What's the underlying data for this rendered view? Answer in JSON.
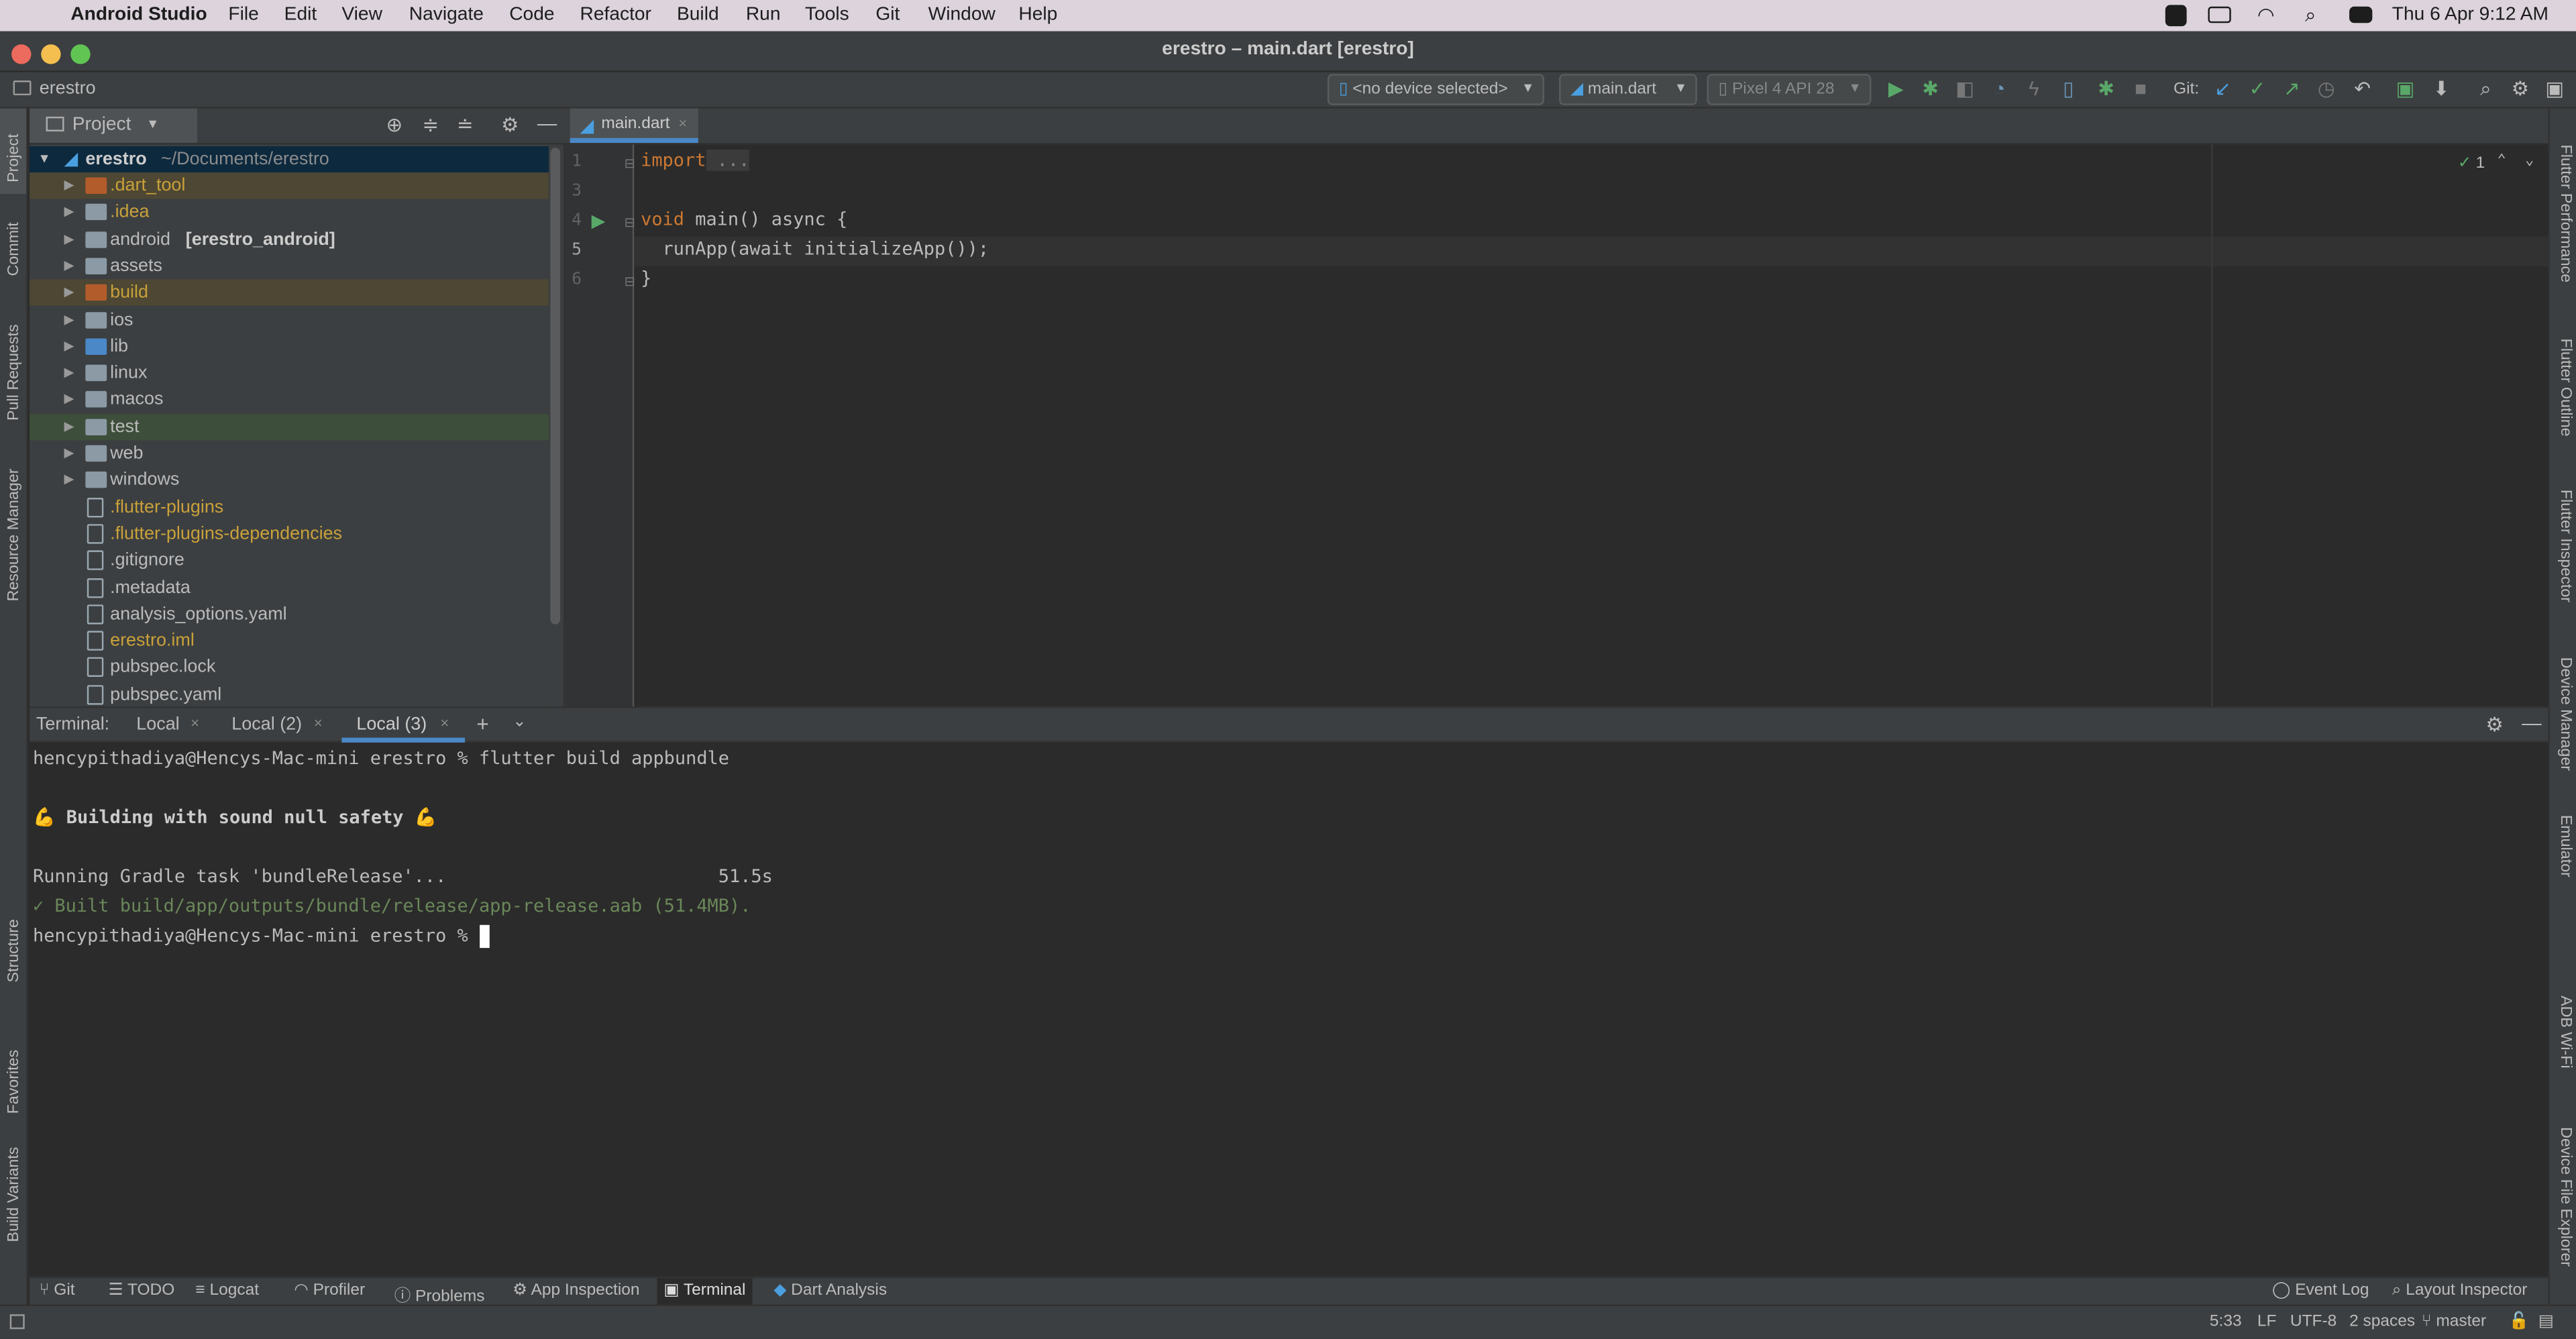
{
  "menubar": {
    "app": "Android Studio",
    "items": [
      "File",
      "Edit",
      "View",
      "Navigate",
      "Code",
      "Refactor",
      "Build",
      "Run",
      "Tools",
      "Git",
      "Window",
      "Help"
    ],
    "datetime": "Thu 6 Apr  9:12 AM"
  },
  "window": {
    "title": "erestro – main.dart [erestro]"
  },
  "navbar": {
    "breadcrumb": "erestro",
    "device": "<no device selected>",
    "run_config": "main.dart",
    "emulator": "Pixel 4 API 28",
    "git_label": "Git:"
  },
  "left_strip": [
    "Project",
    "Commit",
    "Pull Requests",
    "Resource Manager",
    "Structure",
    "Favorites",
    "Build Variants"
  ],
  "right_strip": [
    "Flutter Performance",
    "Flutter Outline",
    "Flutter Inspector",
    "Device Manager",
    "Emulator",
    "ADB Wi-Fi",
    "Device File Explorer"
  ],
  "project": {
    "header": "Project",
    "root_name": "erestro",
    "root_path": "~/Documents/erestro",
    "items": [
      {
        "label": ".dart_tool",
        "color": "#c9a13a"
      },
      {
        "label": ".idea",
        "color": "#c9a13a"
      },
      {
        "label": "android",
        "bold": "[erestro_android]",
        "color": "#bbbbbb"
      },
      {
        "label": "assets",
        "color": "#bbbbbb"
      },
      {
        "label": "build",
        "color": "#c9a13a"
      },
      {
        "label": "ios",
        "color": "#bbbbbb"
      },
      {
        "label": "lib",
        "color": "#bbbbbb"
      },
      {
        "label": "linux",
        "color": "#bbbbbb"
      },
      {
        "label": "macos",
        "color": "#bbbbbb"
      },
      {
        "label": "test",
        "color": "#bbbbbb"
      },
      {
        "label": "web",
        "color": "#bbbbbb"
      },
      {
        "label": "windows",
        "color": "#bbbbbb"
      },
      {
        "label": ".flutter-plugins",
        "color": "#c9a13a"
      },
      {
        "label": ".flutter-plugins-dependencies",
        "color": "#c9a13a"
      },
      {
        "label": ".gitignore",
        "color": "#bbbbbb"
      },
      {
        "label": ".metadata",
        "color": "#bbbbbb"
      },
      {
        "label": "analysis_options.yaml",
        "color": "#bbbbbb"
      },
      {
        "label": "erestro.iml",
        "color": "#c9a13a"
      },
      {
        "label": "pubspec.lock",
        "color": "#bbbbbb"
      },
      {
        "label": "pubspec.yaml",
        "color": "#bbbbbb"
      }
    ]
  },
  "editor": {
    "tab": "main.dart",
    "line_numbers": [
      "1",
      "3",
      "4",
      "5",
      "6"
    ],
    "lines": [
      {
        "kw": "import",
        "rest": " ..."
      },
      {
        "kw": "",
        "rest": ""
      },
      {
        "kw": "void",
        "rest": " main() async {"
      },
      {
        "kw": "",
        "rest": "  runApp(await initializeApp());"
      },
      {
        "kw": "",
        "rest": "}"
      }
    ],
    "inspection_count": "1"
  },
  "terminal": {
    "label": "Terminal:",
    "tabs": [
      "Local",
      "Local (2)",
      "Local (3)"
    ],
    "lines": [
      "hencypithadiya@Hencys-Mac-mini erestro % flutter build appbundle",
      "",
      "💪 Building with sound null safety 💪",
      "",
      "Running Gradle task 'bundleRelease'...                         51.5s",
      "✓ Built build/app/outputs/bundle/release/app-release.aab (51.4MB).",
      "hencypithadiya@Hencys-Mac-mini erestro % "
    ]
  },
  "bottom_tools": [
    "Git",
    "TODO",
    "Logcat",
    "Profiler",
    "Problems",
    "App Inspection",
    "Terminal",
    "Dart Analysis"
  ],
  "bottom_right": [
    "Event Log",
    "Layout Inspector"
  ],
  "status": {
    "position": "5:33",
    "line_sep": "LF",
    "encoding": "UTF-8",
    "indent": "2 spaces",
    "branch": "master"
  },
  "colors": {
    "keyword": "#cc7832",
    "success": "#6a8759",
    "selection": "#2f65ca",
    "highlight_row": "#4d4733"
  }
}
